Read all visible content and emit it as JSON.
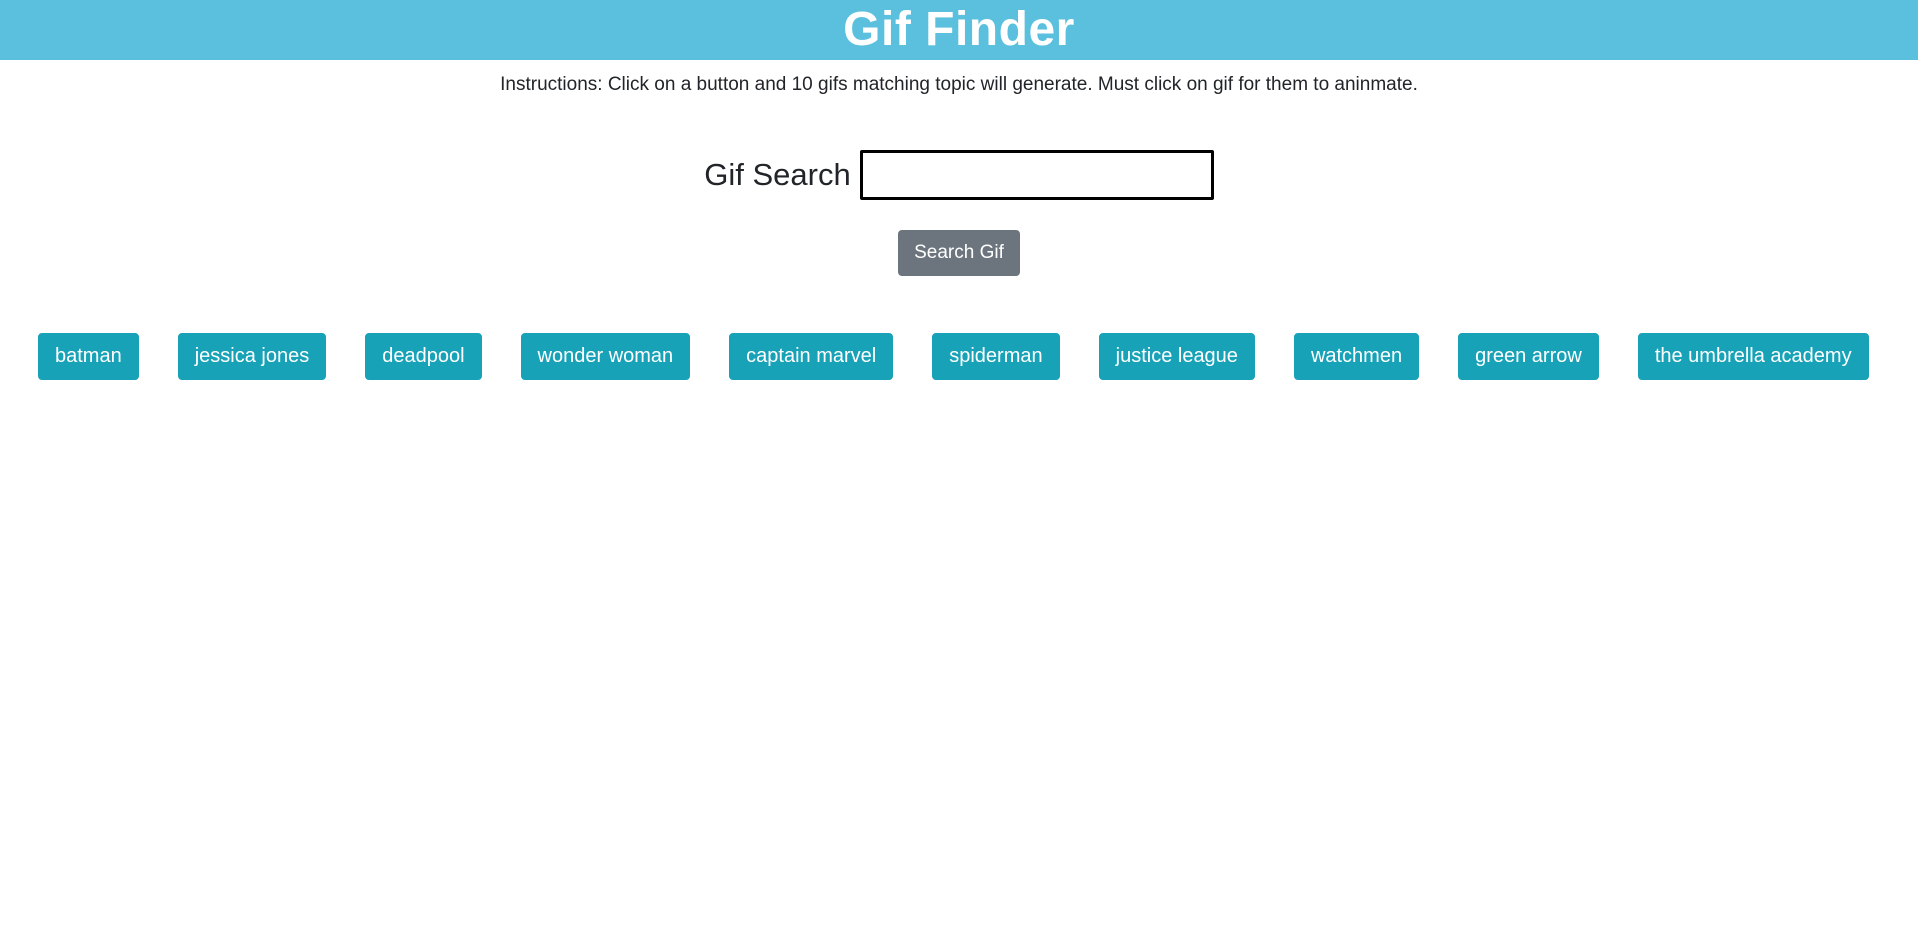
{
  "header": {
    "title": "Gif Finder"
  },
  "instructions": "Instructions: Click on a button and 10 gifs matching topic will generate. Must click on gif for them to aninmate.",
  "search": {
    "label": "Gif Search",
    "value": "",
    "button_label": "Search Gif"
  },
  "topics": [
    "batman",
    "jessica jones",
    "deadpool",
    "wonder woman",
    "captain marvel",
    "spiderman",
    "justice league",
    "watchmen",
    "green arrow",
    "the umbrella academy"
  ],
  "colors": {
    "header_bg": "#5bc0de",
    "topic_button_bg": "#17a2b8",
    "search_button_bg": "#6c757d"
  }
}
